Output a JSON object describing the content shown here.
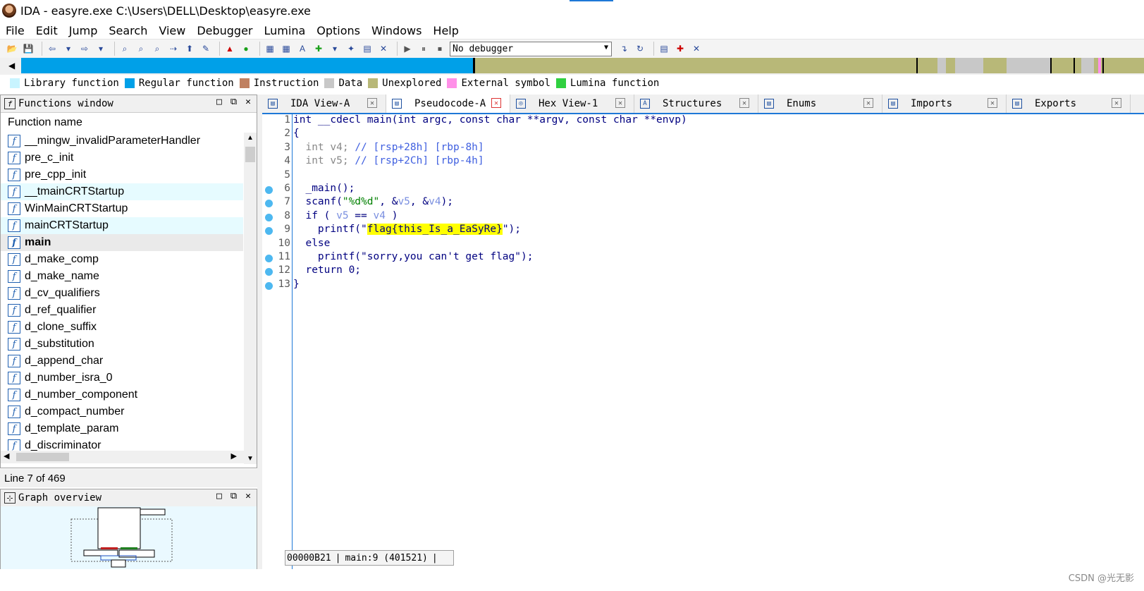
{
  "window": {
    "title": "IDA - easyre.exe C:\\Users\\DELL\\Desktop\\easyre.exe"
  },
  "menu": [
    "File",
    "Edit",
    "Jump",
    "Search",
    "View",
    "Debugger",
    "Lumina",
    "Options",
    "Windows",
    "Help"
  ],
  "toolbar": {
    "debugger_select": "No debugger",
    "icons": [
      "open-icon",
      "save-icon",
      "back-icon",
      "forward-icon",
      "search-icon",
      "run-icon",
      "pause-icon",
      "stop-icon"
    ]
  },
  "legend": [
    {
      "label": "Library function",
      "color": "#c8f4ff"
    },
    {
      "label": "Regular function",
      "color": "#00a0e8"
    },
    {
      "label": "Instruction",
      "color": "#c08060"
    },
    {
      "label": "Data",
      "color": "#c8c8c8"
    },
    {
      "label": "Unexplored",
      "color": "#b8b878"
    },
    {
      "label": "External symbol",
      "color": "#ff90e8"
    },
    {
      "label": "Lumina function",
      "color": "#30d040"
    }
  ],
  "functions_window": {
    "title": "Functions window",
    "column_header": "Function name",
    "items": [
      {
        "name": "__mingw_invalidParameterHandler",
        "state": "normal"
      },
      {
        "name": "pre_c_init",
        "state": "normal"
      },
      {
        "name": "pre_cpp_init",
        "state": "normal"
      },
      {
        "name": "__tmainCRTStartup",
        "state": "hl"
      },
      {
        "name": "WinMainCRTStartup",
        "state": "normal"
      },
      {
        "name": "mainCRTStartup",
        "state": "hl"
      },
      {
        "name": "main",
        "state": "sel"
      },
      {
        "name": "d_make_comp",
        "state": "normal"
      },
      {
        "name": "d_make_name",
        "state": "normal"
      },
      {
        "name": "d_cv_qualifiers",
        "state": "normal"
      },
      {
        "name": "d_ref_qualifier",
        "state": "normal"
      },
      {
        "name": "d_clone_suffix",
        "state": "normal"
      },
      {
        "name": "d_substitution",
        "state": "normal"
      },
      {
        "name": "d_append_char",
        "state": "normal"
      },
      {
        "name": "d_number_isra_0",
        "state": "normal"
      },
      {
        "name": "d_number_component",
        "state": "normal"
      },
      {
        "name": "d_compact_number",
        "state": "normal"
      },
      {
        "name": "d_template_param",
        "state": "normal"
      },
      {
        "name": "d_discriminator",
        "state": "normal"
      }
    ],
    "status": "Line 7 of 469"
  },
  "graph_overview": {
    "title": "Graph overview"
  },
  "tabs": [
    {
      "label": "IDA View-A",
      "active": false
    },
    {
      "label": "Pseudocode-A",
      "active": true
    },
    {
      "label": "Hex View-1",
      "active": false
    },
    {
      "label": "Structures",
      "active": false
    },
    {
      "label": "Enums",
      "active": false
    },
    {
      "label": "Imports",
      "active": false
    },
    {
      "label": "Exports",
      "active": false
    }
  ],
  "code": {
    "lines": [
      {
        "n": "1",
        "bp": false,
        "parts": [
          [
            "int __cdecl main(int argc, const char **argv, const char **envp)",
            ""
          ]
        ]
      },
      {
        "n": "2",
        "bp": false,
        "parts": [
          [
            "{",
            ""
          ]
        ]
      },
      {
        "n": "3",
        "bp": false,
        "parts": [
          [
            "  int v4; ",
            "c-gray"
          ],
          [
            "// [rsp+28h] [rbp-8h]",
            "c-comment"
          ]
        ]
      },
      {
        "n": "4",
        "bp": false,
        "parts": [
          [
            "  int v5; ",
            "c-gray"
          ],
          [
            "// [rsp+2Ch] [rbp-4h]",
            "c-comment"
          ]
        ]
      },
      {
        "n": "5",
        "bp": false,
        "parts": [
          [
            "",
            ""
          ]
        ]
      },
      {
        "n": "6",
        "bp": true,
        "parts": [
          [
            "  _main();",
            ""
          ]
        ]
      },
      {
        "n": "7",
        "bp": true,
        "parts": [
          [
            "  scanf(",
            ""
          ],
          [
            "\"%d%d\"",
            "c-str"
          ],
          [
            ", &",
            ""
          ],
          [
            "v5",
            "c-var"
          ],
          [
            ", &",
            ""
          ],
          [
            "v4",
            "c-var"
          ],
          [
            ");",
            ""
          ]
        ]
      },
      {
        "n": "8",
        "bp": true,
        "parts": [
          [
            "  if ( ",
            ""
          ],
          [
            "v5",
            "c-var"
          ],
          [
            " == ",
            ""
          ],
          [
            "v4",
            "c-var"
          ],
          [
            " )",
            ""
          ]
        ]
      },
      {
        "n": "9",
        "bp": true,
        "parts": [
          [
            "    printf(\"",
            ""
          ],
          [
            "flag{this_Is_a_EaSyRe}",
            "c-hl"
          ],
          [
            "\");",
            ""
          ]
        ]
      },
      {
        "n": "10",
        "bp": false,
        "parts": [
          [
            "  else",
            ""
          ]
        ]
      },
      {
        "n": "11",
        "bp": true,
        "parts": [
          [
            "    printf(\"sorry,you can't get flag\");",
            ""
          ]
        ]
      },
      {
        "n": "12",
        "bp": true,
        "parts": [
          [
            "  return 0;",
            ""
          ]
        ]
      },
      {
        "n": "13",
        "bp": true,
        "parts": [
          [
            "}",
            ""
          ]
        ]
      }
    ],
    "status_address": "00000B21",
    "status_location": "main:9 (401521)"
  },
  "watermark": "CSDN @光无影"
}
